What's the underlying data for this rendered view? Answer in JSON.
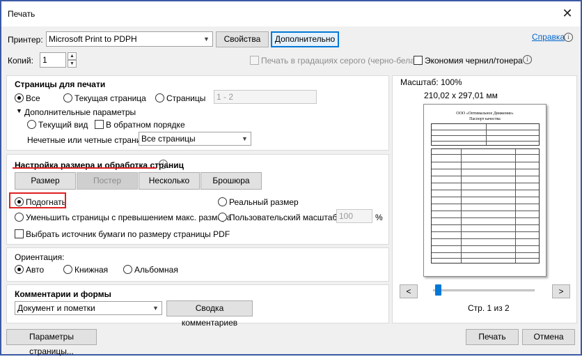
{
  "window": {
    "title": "Печать",
    "close_glyph": "✕"
  },
  "printer": {
    "label": "Принтер:",
    "selected": "Microsoft Print to PDPH",
    "properties_button": "Свойства",
    "advanced_button": "Дополнительно",
    "help_link": "Справка"
  },
  "copies": {
    "label": "Копий:",
    "value": "1"
  },
  "options": {
    "grayscale": "Печать в градациях серого (черно-белая)",
    "save_ink": "Экономия чернил/тонера"
  },
  "pages_to_print": {
    "heading": "Страницы для печати",
    "all": "Все",
    "current": "Текущая страница",
    "pages": "Страницы",
    "pages_value": "1 - 2",
    "more_options": "Дополнительные параметры",
    "current_view": "Текущий вид",
    "reverse": "В обратном порядке",
    "odd_even_label": "Нечетные или четные страницы:",
    "odd_even_value": "Все страницы"
  },
  "sizing": {
    "heading": "Настройка размера и обработка страниц",
    "tabs": [
      "Размер",
      "Постер",
      "Несколько",
      "Брошюра"
    ],
    "fit": "Подогнать",
    "actual_size": "Реальный размер",
    "shrink": "Уменьшить страницы с превышением макс. размера",
    "custom_scale": "Пользовательский масштаб:",
    "custom_scale_value": "100",
    "percent": "%",
    "paper_source": "Выбрать источник бумаги по размеру страницы PDF"
  },
  "orientation": {
    "heading": "Ориентация:",
    "auto": "Авто",
    "portrait": "Книжная",
    "landscape": "Альбомная"
  },
  "comments": {
    "heading": "Комментарии и формы",
    "selected": "Документ и пометки",
    "summary_button": "Сводка комментариев"
  },
  "preview": {
    "scale": "Масштаб: 100%",
    "dimensions": "210,02 x 297,01 мм",
    "doc_line1": "ООО «Оптимальное Движение»",
    "doc_line2": "Паспорт качества",
    "prev": "<",
    "next": ">",
    "page_info": "Стр. 1 из 2"
  },
  "footer": {
    "page_setup": "Параметры страницы...",
    "print": "Печать",
    "cancel": "Отмена"
  },
  "colors": {
    "accent": "#0078d7",
    "highlight": "#e02020",
    "frame": "#3b59a4"
  }
}
